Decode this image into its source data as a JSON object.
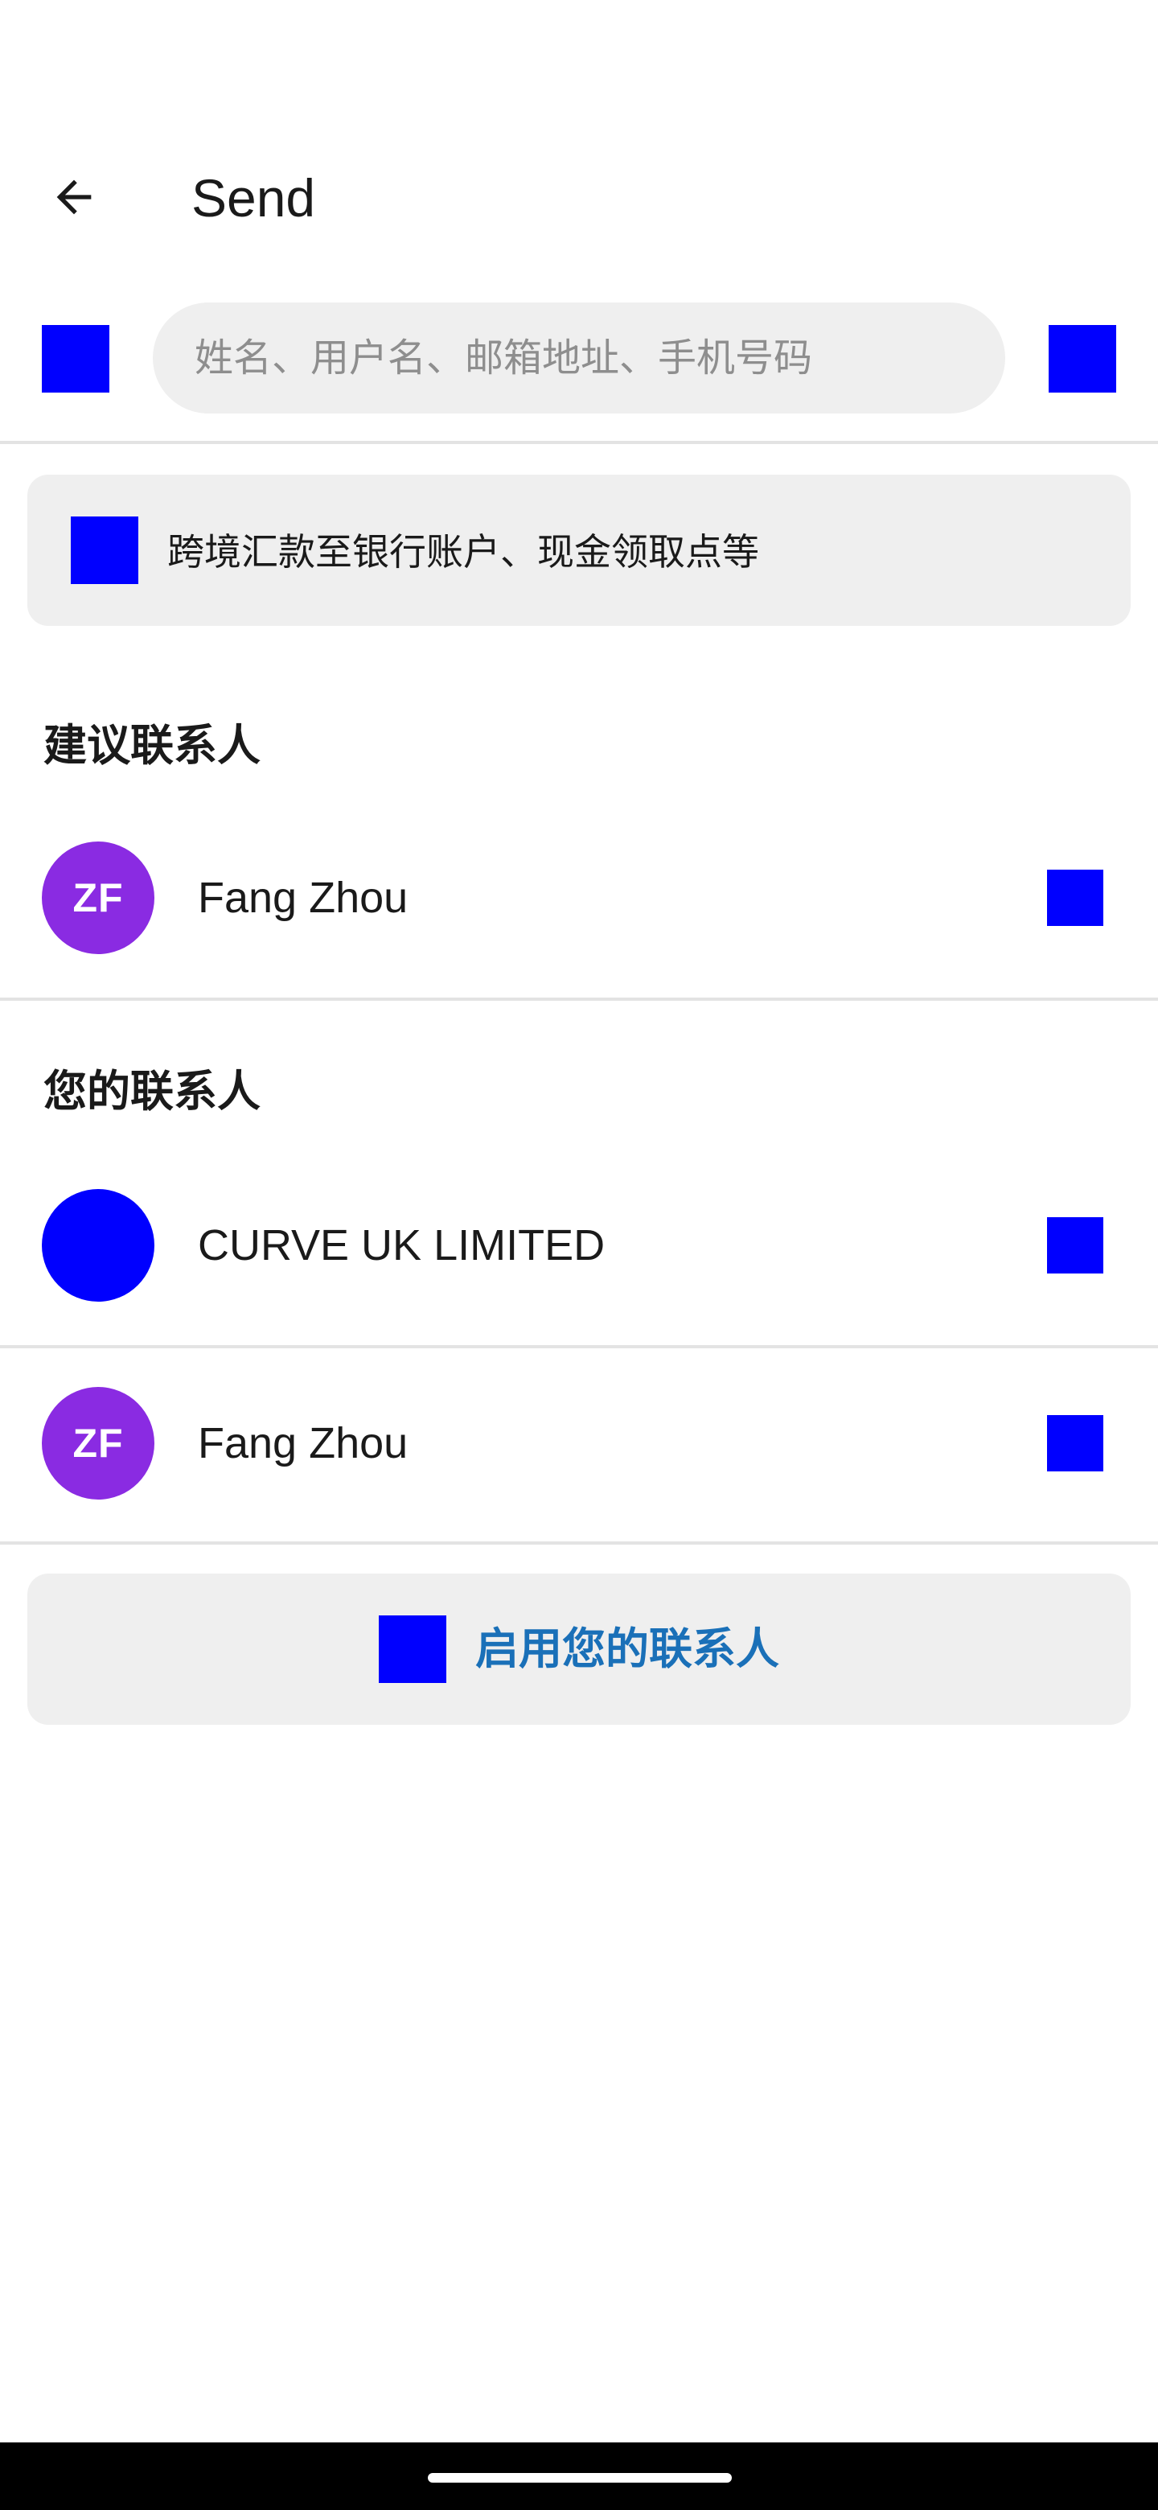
{
  "header": {
    "title": "Send",
    "back_icon": "arrow-left-icon"
  },
  "search": {
    "placeholder": "姓名、用户名、邮箱地址、手机号码",
    "value": "",
    "left_icon": "blue-square-icon",
    "right_icon": "blue-square-icon"
  },
  "cross_border": {
    "label": "跨境汇款至银行账户、现金领取点等",
    "icon": "blue-square-icon"
  },
  "suggested": {
    "heading": "建议联系人",
    "contacts": [
      {
        "name": "Fang Zhou",
        "initials": "ZF",
        "avatar_color": "#8a2be2"
      }
    ]
  },
  "your_contacts": {
    "heading": "您的联系人",
    "contacts": [
      {
        "name": "CURVE UK LIMITED",
        "initials": "",
        "avatar_color": "#0000ff"
      },
      {
        "name": "Fang Zhou",
        "initials": "ZF",
        "avatar_color": "#8a2be2"
      }
    ]
  },
  "enable_contacts": {
    "label": "启用您的联系人",
    "icon": "blue-square-icon",
    "label_color": "#1a70b8"
  },
  "colors": {
    "placeholder_icon": "#0000ff",
    "card_background": "#efefef",
    "divider": "#e3e3e3"
  }
}
